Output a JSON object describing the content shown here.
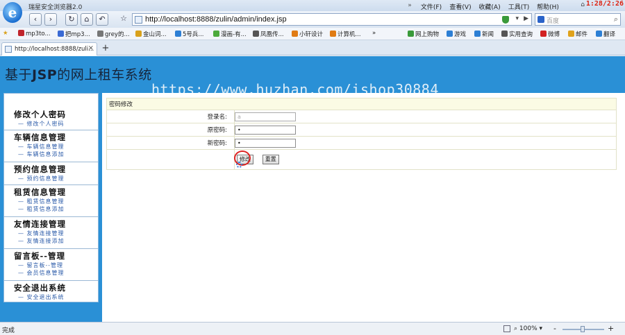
{
  "browser": {
    "app_title": "瑞星安全浏览器2.0",
    "menu": [
      "文件(F)",
      "查看(V)",
      "收藏(A)",
      "工具(T)",
      "帮助(H)"
    ],
    "clock": "1:28/2:26",
    "address": "http://localhost:8888/zulin/admin/index.jsp",
    "search_placeholder": "百度",
    "favorites": [
      {
        "label": "mp3to...",
        "color": "#c0242b"
      },
      {
        "label": "把mp3...",
        "color": "#3a6ad4"
      },
      {
        "label": "grey的...",
        "color": "#777777"
      },
      {
        "label": "金山词...",
        "color": "#d9a11b"
      },
      {
        "label": "5号兵...",
        "color": "#2d7fd4"
      },
      {
        "label": "漫画-有...",
        "color": "#4caa3c"
      },
      {
        "label": "凤凰传...",
        "color": "#555555"
      },
      {
        "label": "小轩设计",
        "color": "#e07b14"
      },
      {
        "label": "计算机...",
        "color": "#e07b14"
      },
      {
        "label": "网上购物",
        "color": "#3a9a3a"
      },
      {
        "label": "游戏",
        "color": "#2d7fd4"
      },
      {
        "label": "新闻",
        "color": "#2d7fd4"
      },
      {
        "label": "实用查询",
        "color": "#555555"
      },
      {
        "label": "微博",
        "color": "#d22222"
      },
      {
        "label": "邮件",
        "color": "#e0a21b"
      },
      {
        "label": "翻译",
        "color": "#2d7fd4"
      }
    ],
    "more_label": "»",
    "tab_label": "http://localhost:8888/zuli...",
    "tab_close": "×",
    "new_tab": "+",
    "status": "完成",
    "zoom": "100%"
  },
  "page": {
    "system_title_pre": "基于",
    "system_title_bold": "JSP",
    "system_title_post": "的网上租车系统",
    "watermark": "https://www.huzhan.com/ishop30884",
    "sidebar": [
      {
        "title": "修改个人密码",
        "links": [
          "修改个人密码"
        ]
      },
      {
        "title": "车辆信息管理",
        "links": [
          "车辆信息管理",
          "车辆信息添加"
        ]
      },
      {
        "title": "预约信息管理",
        "links": [
          "预约信息管理"
        ]
      },
      {
        "title": "租赁信息管理",
        "links": [
          "租赁信息管理",
          "租赁信息添加"
        ]
      },
      {
        "title": "友情连接管理",
        "links": [
          "友情连接管理",
          "友情连接添加"
        ]
      },
      {
        "title": "留言板--管理",
        "links": [
          "留言板--管理",
          "会员信息管理"
        ]
      },
      {
        "title": "安全退出系统",
        "links": [
          "安全退出系统"
        ]
      }
    ],
    "form": {
      "header": "密码修改",
      "login_label": "登录名:",
      "login_value": "a",
      "old_pwd_label": "原密码:",
      "old_pwd_value": "•",
      "new_pwd_label": "新密码:",
      "new_pwd_value": "•",
      "submit_label": "修改",
      "reset_label": "重置"
    }
  }
}
